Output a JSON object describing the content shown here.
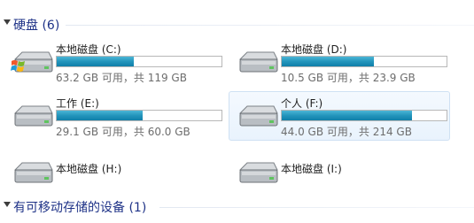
{
  "hard_disks_group": {
    "header": "硬盘 (6)",
    "drives": [
      {
        "name": "本地磁盘 (C:)",
        "size_text": "63.2 GB 可用，共 119 GB",
        "used_fraction": 0.47,
        "system": true
      },
      {
        "name": "本地磁盘 (D:)",
        "size_text": "10.5 GB 可用，共 23.9 GB",
        "used_fraction": 0.56,
        "system": false
      },
      {
        "name": "工作 (E:)",
        "size_text": "29.1 GB 可用，共 60.0 GB",
        "used_fraction": 0.52,
        "system": false
      },
      {
        "name": "个人 (F:)",
        "size_text": "44.0 GB 可用，共 214 GB",
        "used_fraction": 0.79,
        "system": false,
        "selected": true
      },
      {
        "name": "本地磁盘 (H:)"
      },
      {
        "name": "本地磁盘 (I:)"
      }
    ]
  },
  "removable_group": {
    "header": "有可移动存储的设备 (1)"
  },
  "colors": {
    "group_header": "#1e3287",
    "capacity_fill": "#2495bc",
    "secondary_text": "#6d6d6d",
    "selection": "#e9f3fd"
  },
  "icons": {
    "drive": "hard-drive-icon",
    "system_badge": "windows-logo-icon"
  }
}
